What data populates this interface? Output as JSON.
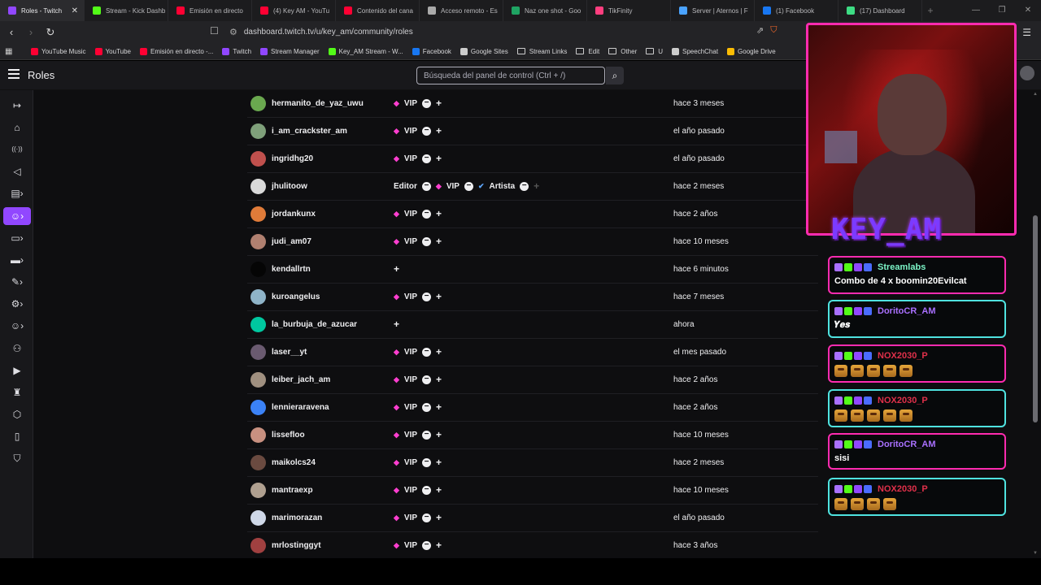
{
  "browser": {
    "tabs": [
      {
        "label": "Roles - Twitch",
        "color": "#9147ff",
        "active": true
      },
      {
        "label": "Stream - Kick Dashb",
        "color": "#53fc18"
      },
      {
        "label": "Emisión en directo",
        "color": "#ff0033"
      },
      {
        "label": "(4) Key AM - YouTu",
        "color": "#ff0033"
      },
      {
        "label": "Contenido del cana",
        "color": "#ff0033"
      },
      {
        "label": "Acceso remoto - Es",
        "color": "#aaaaaa"
      },
      {
        "label": "Naz one shot - Goo",
        "color": "#1fa463"
      },
      {
        "label": "TikFinity",
        "color": "#ff3e7f"
      },
      {
        "label": "Server | Aternos | F",
        "color": "#4aa3ff"
      },
      {
        "label": "(1) Facebook",
        "color": "#1877f2"
      },
      {
        "label": "(17) Dashboard",
        "color": "#3ddc84"
      }
    ],
    "url": "dashboard.twitch.tv/u/key_am/community/roles",
    "bookmarks": [
      {
        "label": "YouTube Music",
        "color": "#ff0033",
        "type": "site"
      },
      {
        "label": "YouTube",
        "color": "#ff0033",
        "type": "site"
      },
      {
        "label": "Emisión en directo -...",
        "color": "#ff0033",
        "type": "site"
      },
      {
        "label": "Twitch",
        "color": "#9147ff",
        "type": "site"
      },
      {
        "label": "Stream Manager",
        "color": "#9147ff",
        "type": "site"
      },
      {
        "label": "Key_AM Stream - W...",
        "color": "#53fc18",
        "type": "site"
      },
      {
        "label": "Facebook",
        "color": "#1877f2",
        "type": "site"
      },
      {
        "label": "Google Sites",
        "color": "#cccccc",
        "type": "site"
      },
      {
        "label": "Stream Links",
        "type": "folder"
      },
      {
        "label": "Edit",
        "type": "folder"
      },
      {
        "label": "Other",
        "type": "folder"
      },
      {
        "label": "U",
        "type": "folder"
      },
      {
        "label": "SpeechChat",
        "color": "#cccccc",
        "type": "site"
      },
      {
        "label": "Google Drive",
        "color": "#fbbc04",
        "type": "site"
      }
    ]
  },
  "header": {
    "title": "Roles",
    "search_placeholder": "Búsqueda del panel de control (Ctrl + /)"
  },
  "rows": [
    {
      "name": "hermanito_de_yaz_uwu",
      "roles": [
        "VIP"
      ],
      "when": "hace 3 meses",
      "avatar": "#6aa84f"
    },
    {
      "name": "i_am_crackster_am",
      "roles": [
        "VIP"
      ],
      "when": "el año pasado",
      "avatar": "#7fa07a"
    },
    {
      "name": "ingridhg20",
      "roles": [
        "VIP"
      ],
      "when": "el año pasado",
      "avatar": "#c0504d"
    },
    {
      "name": "jhulitoow",
      "roles": [
        "Editor",
        "VIP",
        "Artista"
      ],
      "when": "hace 2 meses",
      "avatar": "#d9d9d9"
    },
    {
      "name": "jordankunx",
      "roles": [
        "VIP"
      ],
      "when": "hace 2 años",
      "avatar": "#e07b39"
    },
    {
      "name": "judi_am07",
      "roles": [
        "VIP"
      ],
      "when": "hace 10 meses",
      "avatar": "#b08070"
    },
    {
      "name": "kendallrtn",
      "roles": [],
      "when": "hace 6 minutos",
      "avatar": "#050505"
    },
    {
      "name": "kuroangelus",
      "roles": [
        "VIP"
      ],
      "when": "hace 7 meses",
      "avatar": "#8fb4c8"
    },
    {
      "name": "la_burbuja_de_azucar",
      "roles": [],
      "when": "ahora",
      "avatar": "#00c8a0"
    },
    {
      "name": "laser__yt",
      "roles": [
        "VIP"
      ],
      "when": "el mes pasado",
      "avatar": "#6a5a70"
    },
    {
      "name": "leiber_jach_am",
      "roles": [
        "VIP"
      ],
      "when": "hace 2 años",
      "avatar": "#a09080"
    },
    {
      "name": "lennieraravena",
      "roles": [
        "VIP"
      ],
      "when": "hace 2 años",
      "avatar": "#3b82f6"
    },
    {
      "name": "lissefloo",
      "roles": [
        "VIP"
      ],
      "when": "hace 10 meses",
      "avatar": "#c89080"
    },
    {
      "name": "maikolcs24",
      "roles": [
        "VIP"
      ],
      "when": "hace 2 meses",
      "avatar": "#6a4a40"
    },
    {
      "name": "mantraexp",
      "roles": [
        "VIP"
      ],
      "when": "hace 10 meses",
      "avatar": "#b0a090"
    },
    {
      "name": "marimorazan",
      "roles": [
        "VIP"
      ],
      "when": "el año pasado",
      "avatar": "#cfd8e8"
    },
    {
      "name": "mrlostinggyt",
      "roles": [
        "VIP"
      ],
      "when": "hace 3 años",
      "avatar": "#a04040"
    }
  ],
  "overlay": {
    "cam_name": "KEY_AM",
    "chat": [
      {
        "user": "Streamlabs",
        "user_color": "#7cf5c8",
        "text": "Combo de 4 x boomin20Evilcat",
        "emotes": 0,
        "border": "#ff2bb0"
      },
      {
        "user": "DoritoCR_AM",
        "user_color": "#a970ff",
        "text": "𝒀𝒆𝒔",
        "emotes": 0,
        "border": "#4fe3e0"
      },
      {
        "user": "NOX2030_P",
        "user_color": "#e0304a",
        "text": "",
        "emotes": 5,
        "border": "#ff2bb0"
      },
      {
        "user": "NOX2030_P",
        "user_color": "#e0304a",
        "text": "",
        "emotes": 5,
        "border": "#4fe3e0"
      },
      {
        "user": "DoritoCR_AM",
        "user_color": "#a970ff",
        "text": "sisi",
        "emotes": 0,
        "border": "#ff2bb0"
      },
      {
        "user": "NOX2030_P",
        "user_color": "#e0304a",
        "text": "",
        "emotes": 4,
        "border": "#4fe3e0"
      }
    ]
  },
  "nav_icons": [
    "collapse-icon",
    "home-icon",
    "stream-icon",
    "megaphone-icon",
    "analytics-icon",
    "community-icon",
    "content-icon",
    "monetization-icon",
    "creator-tools-icon",
    "settings-icon",
    "viewer-rewards-icon",
    "add-user-icon",
    "video-icon",
    "trophy-icon",
    "extensions-icon",
    "learn-icon",
    "safety-icon"
  ]
}
